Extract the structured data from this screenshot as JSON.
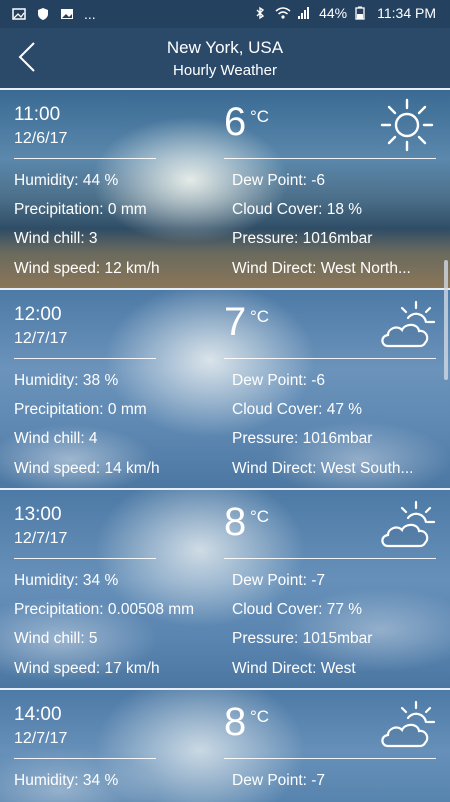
{
  "status_bar": {
    "left_dots": "...",
    "battery": "44%",
    "time": "11:34 PM"
  },
  "header": {
    "title": "New York, USA",
    "subtitle": "Hourly Weather"
  },
  "cards": [
    {
      "time": "11:00",
      "date": "12/6/17",
      "temp": "6",
      "unit": "°C",
      "icon": "sun-icon",
      "humidity": "Humidity: 44 %",
      "precipitation": "Precipitation: 0 mm",
      "wind_chill": "Wind chill: 3",
      "wind_speed": "Wind speed: 12 km/h",
      "dew_point": "Dew Point: -6",
      "cloud_cover": "Cloud Cover: 18 %",
      "pressure": "Pressure: 1016mbar",
      "wind_direct": "Wind Direct: West North..."
    },
    {
      "time": "12:00",
      "date": "12/7/17",
      "temp": "7",
      "unit": "°C",
      "icon": "partly-cloudy-icon",
      "humidity": "Humidity: 38 %",
      "precipitation": "Precipitation: 0 mm",
      "wind_chill": "Wind chill: 4",
      "wind_speed": "Wind speed: 14 km/h",
      "dew_point": "Dew Point: -6",
      "cloud_cover": "Cloud Cover: 47 %",
      "pressure": "Pressure: 1016mbar",
      "wind_direct": "Wind Direct: West South..."
    },
    {
      "time": "13:00",
      "date": "12/7/17",
      "temp": "8",
      "unit": "°C",
      "icon": "partly-cloudy-icon",
      "humidity": "Humidity: 34 %",
      "precipitation": "Precipitation: 0.00508 mm",
      "wind_chill": "Wind chill: 5",
      "wind_speed": "Wind speed: 17 km/h",
      "dew_point": "Dew Point: -7",
      "cloud_cover": "Cloud Cover: 77 %",
      "pressure": "Pressure: 1015mbar",
      "wind_direct": "Wind Direct: West"
    },
    {
      "time": "14:00",
      "date": "12/7/17",
      "temp": "8",
      "unit": "°C",
      "icon": "partly-cloudy-icon",
      "humidity": "Humidity: 34 %",
      "precipitation": "",
      "wind_chill": "",
      "wind_speed": "",
      "dew_point": "Dew Point: -7",
      "cloud_cover": "",
      "pressure": "",
      "wind_direct": ""
    }
  ]
}
